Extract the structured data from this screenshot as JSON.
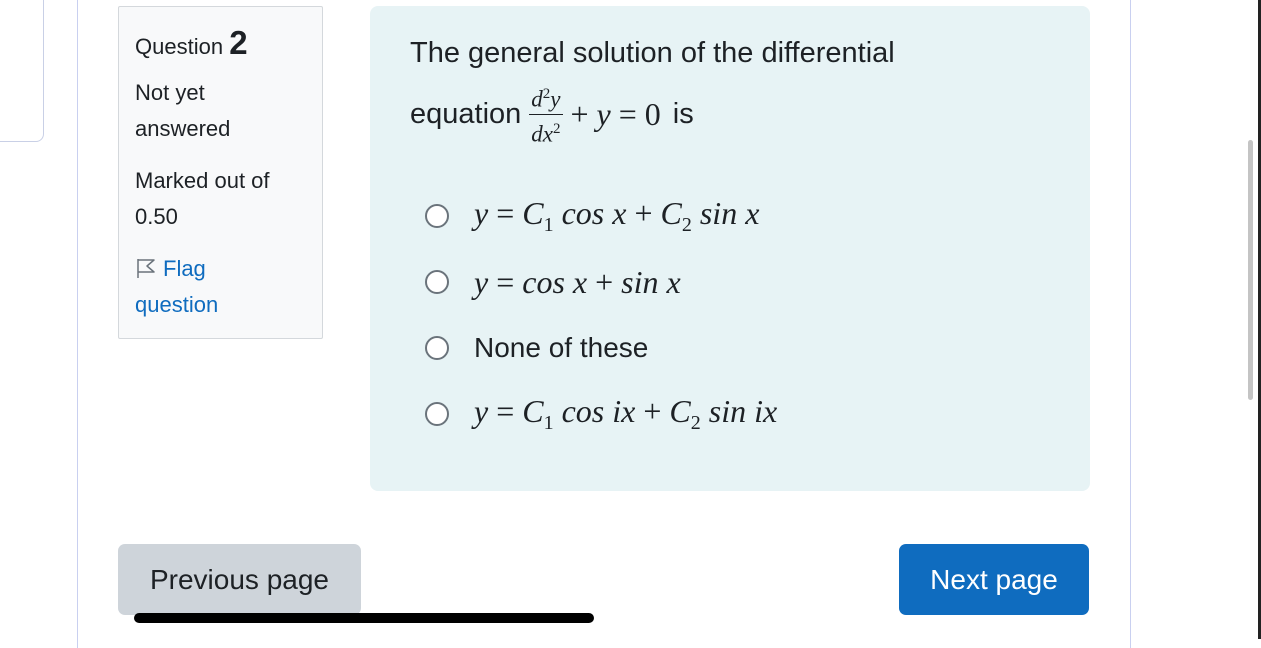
{
  "question_info": {
    "label": "Question",
    "number": "2",
    "state_line1": "Not yet",
    "state_line2": "answered",
    "grade_line1": "Marked out of",
    "grade_line2": "0.50",
    "flag_line1": "Flag",
    "flag_line2": "question"
  },
  "question": {
    "text_line1": "The general solution of the differential",
    "text_prefix": "equation",
    "text_suffix": "is",
    "equation": "d²y/dx² + y = 0"
  },
  "options": [
    {
      "label": "y = C1 cos x + C2 sin x",
      "selected": false
    },
    {
      "label": "y = cos x + sin x",
      "selected": false
    },
    {
      "label": "None of these",
      "selected": false
    },
    {
      "label": "y = C1 cos ix + C2 sin ix",
      "selected": false
    }
  ],
  "navigation": {
    "previous_label": "Previous page",
    "next_label": "Next page"
  },
  "colors": {
    "accent": "#0f6cbf",
    "content_bg": "#e7f3f5",
    "info_bg": "#f8f9fa",
    "secondary_button": "#ced4da"
  }
}
